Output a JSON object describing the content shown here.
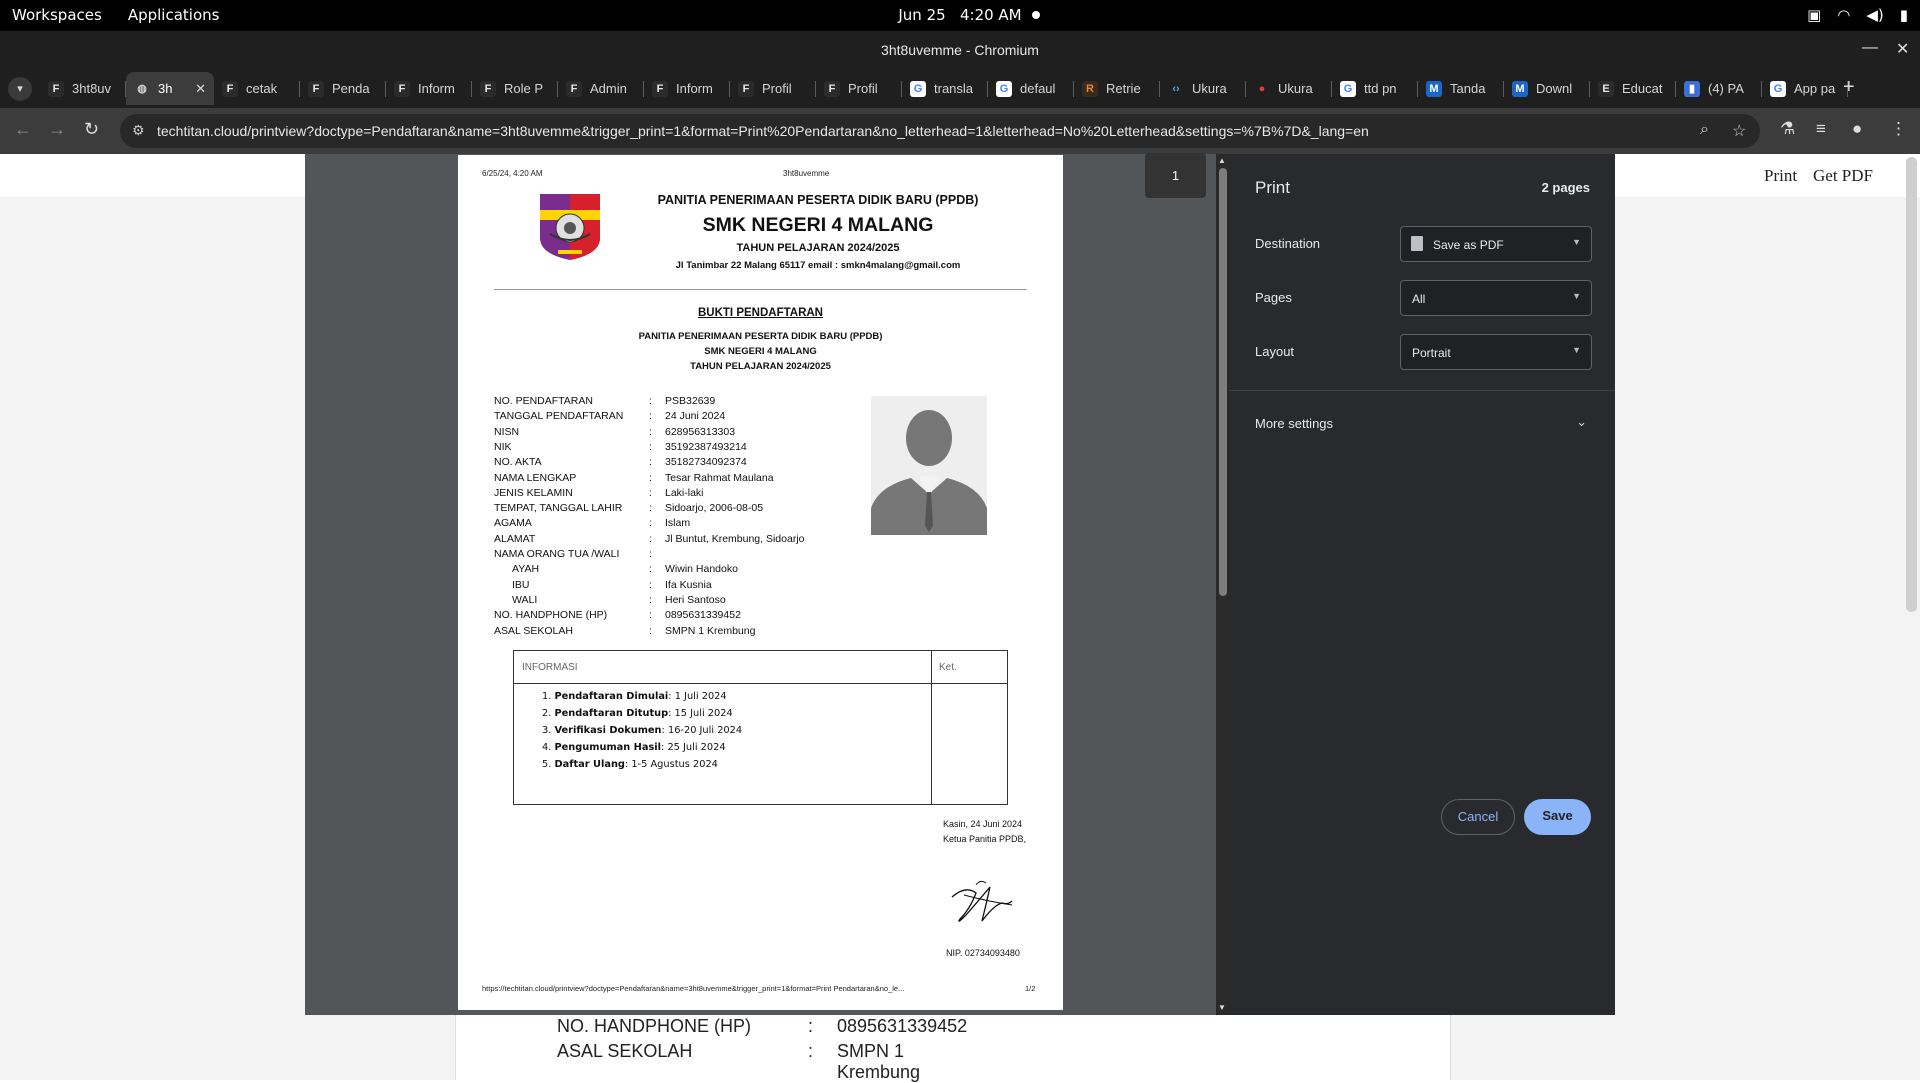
{
  "system_bar": {
    "workspaces": "Workspaces",
    "applications": "Applications",
    "date": "Jun 25",
    "time": "4:20 AM"
  },
  "window": {
    "title": "3ht8uvemme - Chromium"
  },
  "tabs": [
    {
      "label": "3ht8uv",
      "icon": "frappe-f"
    },
    {
      "label": "3h",
      "icon": "globe",
      "active": true
    },
    {
      "label": "cetak",
      "icon": "frappe-f"
    },
    {
      "label": "Penda",
      "icon": "frappe-f"
    },
    {
      "label": "Inform",
      "icon": "frappe-f"
    },
    {
      "label": "Role P",
      "icon": "frappe-f"
    },
    {
      "label": "Admin",
      "icon": "frappe-f"
    },
    {
      "label": "Inform",
      "icon": "frappe-f"
    },
    {
      "label": "Profil",
      "icon": "frappe-f"
    },
    {
      "label": "Profil",
      "icon": "frappe-f"
    },
    {
      "label": "transla",
      "icon": "google-g"
    },
    {
      "label": "defaul",
      "icon": "google-g"
    },
    {
      "label": "Retrie",
      "icon": "retrieve"
    },
    {
      "label": "Ukura",
      "icon": "code-brackets"
    },
    {
      "label": "Ukura",
      "icon": "red-logo"
    },
    {
      "label": "ttd pn",
      "icon": "google-g"
    },
    {
      "label": "Tanda",
      "icon": "canva-m"
    },
    {
      "label": "Downl",
      "icon": "canva-m"
    },
    {
      "label": "Educat",
      "icon": "e-logo"
    },
    {
      "label": "(4) PA",
      "icon": "book"
    },
    {
      "label": "App pa",
      "icon": "google-g"
    }
  ],
  "address_bar": {
    "url": "techtitan.cloud/printview?doctype=Pendaftaran&name=3ht8uvemme&trigger_print=1&format=Print%20Pendartaran&no_letterhead=1&letterhead=No%20Letterhead&settings=%7B%7D&_lang=en"
  },
  "page_behind": {
    "print_label": "Print",
    "get_pdf_label": "Get PDF",
    "row_hp_label": "NO. HANDPHONE (HP)",
    "row_hp_colon": ":",
    "row_hp_value": "0895631339452",
    "row_school_label": "ASAL SEKOLAH",
    "row_school_colon": ":",
    "row_school_value": "SMPN 1 Krembung"
  },
  "preview": {
    "page_number": "1",
    "header_datetime": "6/25/24, 4:20 AM",
    "header_name": "3ht8uvemme",
    "org_line1": "PANITIA PENERIMAAN PESERTA DIDIK BARU (PPDB)",
    "school_name": "SMK NEGERI 4 MALANG",
    "year": "TAHUN PELAJARAN 2024/2025",
    "address": "Jl Tanimbar 22 Malang 65117 email : smkn4malang@gmail.com",
    "doc_title": "BUKTI PENDAFTARAN",
    "sub1": "PANITIA PENERIMAAN PESERTA DIDIK BARU (PPDB)",
    "sub2": "SMK NEGERI 4 MALANG",
    "sub3": "TAHUN PELAJARAN 2024/2025",
    "fields": [
      {
        "label": "NO. PENDAFTARAN",
        "colon": ":",
        "value": "PSB32639"
      },
      {
        "label": "TANGGAL PENDAFTARAN",
        "colon": ":",
        "value": "24 Juni 2024"
      },
      {
        "label": "NISN",
        "colon": ":",
        "value": "628956313303"
      },
      {
        "label": "NIK",
        "colon": ":",
        "value": "35192387493214"
      },
      {
        "label": "NO. AKTA",
        "colon": ":",
        "value": "35182734092374"
      },
      {
        "label": "NAMA LENGKAP",
        "colon": ":",
        "value": "Tesar Rahmat Maulana"
      },
      {
        "label": "JENIS KELAMIN",
        "colon": ":",
        "value": "Laki-laki"
      },
      {
        "label": "TEMPAT, TANGGAL LAHIR",
        "colon": ":",
        "value": "Sidoarjo, 2006-08-05"
      },
      {
        "label": "AGAMA",
        "colon": ":",
        "value": "Islam"
      },
      {
        "label": "ALAMAT",
        "colon": ":",
        "value": "Jl Buntut, Krembung, Sidoarjo"
      },
      {
        "label": "NAMA ORANG TUA /WALI",
        "colon": ":",
        "value": ""
      },
      {
        "label": "AYAH",
        "colon": ":",
        "value": "Wiwin Handoko",
        "indent": true
      },
      {
        "label": "IBU",
        "colon": ":",
        "value": "Ifa Kusnia",
        "indent": true
      },
      {
        "label": "WALI",
        "colon": ":",
        "value": "Heri Santoso",
        "indent": true
      },
      {
        "label": "NO. HANDPHONE (HP)",
        "colon": ":",
        "value": "0895631339452"
      },
      {
        "label": "ASAL SEKOLAH",
        "colon": ":",
        "value": "SMPN 1 Krembung"
      }
    ],
    "info_header": "INFORMASI",
    "ket_header": "Ket.",
    "info_items": [
      {
        "num": "1.",
        "key": "Pendaftaran Dimulai",
        "value": ": 1 Juli 2024"
      },
      {
        "num": "2.",
        "key": "Pendaftaran Ditutup",
        "value": ": 15 Juli 2024"
      },
      {
        "num": "3.",
        "key": "Verifikasi Dokumen",
        "value": ": 16-20 Juli 2024"
      },
      {
        "num": "4.",
        "key": "Pengumuman Hasil",
        "value": ": 25 Juli 2024"
      },
      {
        "num": "5.",
        "key": "Daftar Ulang",
        "value": ": 1-5 Agustus 2024"
      }
    ],
    "place_date": "Kasin, 24 Juni 2024",
    "signatory_title": "Ketua Panitia PPDB,",
    "nip": "NIP. 02734093480",
    "footer_url": "https://techtitan.cloud/printview?doctype=Pendaftaran&name=3ht8uvemme&trigger_print=1&format=Print Pendartaran&no_le...",
    "footer_page": "1/2"
  },
  "print_panel": {
    "title": "Print",
    "page_count": "2 pages",
    "destination_label": "Destination",
    "destination_value": "Save as PDF",
    "pages_label": "Pages",
    "pages_value": "All",
    "layout_label": "Layout",
    "layout_value": "Portrait",
    "more_settings": "More settings",
    "cancel": "Cancel",
    "save": "Save"
  }
}
